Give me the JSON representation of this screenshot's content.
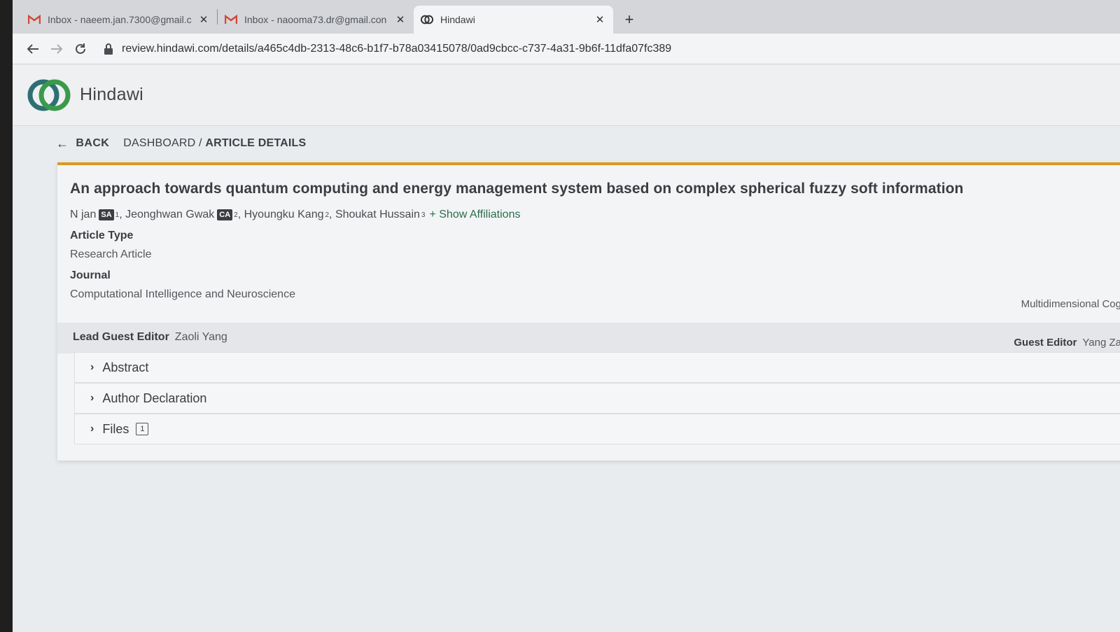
{
  "browser": {
    "tabs": [
      {
        "title": "Inbox - naeem.jan.7300@gmail.c",
        "icon": "gmail-icon",
        "active": false
      },
      {
        "title": "Inbox - naooma73.dr@gmail.con",
        "icon": "gmail-icon",
        "active": false
      },
      {
        "title": "Hindawi",
        "icon": "hindawi-icon",
        "active": true
      }
    ],
    "close_glyph": "✕",
    "new_tab_glyph": "+",
    "url": "review.hindawi.com/details/a465c4db-2313-48c6-b1f7-b78a03415078/0ad9cbcc-c737-4a31-9b6f-11dfa07fc389"
  },
  "header": {
    "brand": "Hindawi"
  },
  "breadcrumb": {
    "back_label": "BACK",
    "path": "DASHBOARD / ",
    "current": "ARTICLE DETAILS"
  },
  "article": {
    "title": "An approach towards quantum computing and energy management system based on complex spherical fuzzy soft information",
    "authors": [
      {
        "name": "N jan",
        "badge": "SA",
        "aff": "1"
      },
      {
        "name": "Jeonghwan Gwak",
        "badge": "CA",
        "aff": "2"
      },
      {
        "name": "Hyoungku Kang",
        "badge": "",
        "aff": "2"
      },
      {
        "name": "Shoukat Hussain",
        "badge": "",
        "aff": "3"
      }
    ],
    "show_affiliations": "+ Show Affiliations",
    "article_type_label": "Article Type",
    "article_type": "Research Article",
    "journal_label": "Journal",
    "journal": "Computational Intelligence and Neuroscience",
    "special_issue": "Multidimensional Cog",
    "lead_guest_editor_label": "Lead Guest Editor",
    "lead_guest_editor": "Zaoli Yang",
    "guest_editor_label": "Guest Editor",
    "guest_editor": "Yang Za"
  },
  "sections": [
    {
      "label": "Abstract",
      "count": ""
    },
    {
      "label": "Author Declaration",
      "count": ""
    },
    {
      "label": "Files",
      "count": "1"
    }
  ],
  "colors": {
    "accent_bar": "#d99a1f",
    "logo_green": "#3a9a4a",
    "logo_teal": "#2f6f73",
    "link_green": "#2a6d4b"
  }
}
